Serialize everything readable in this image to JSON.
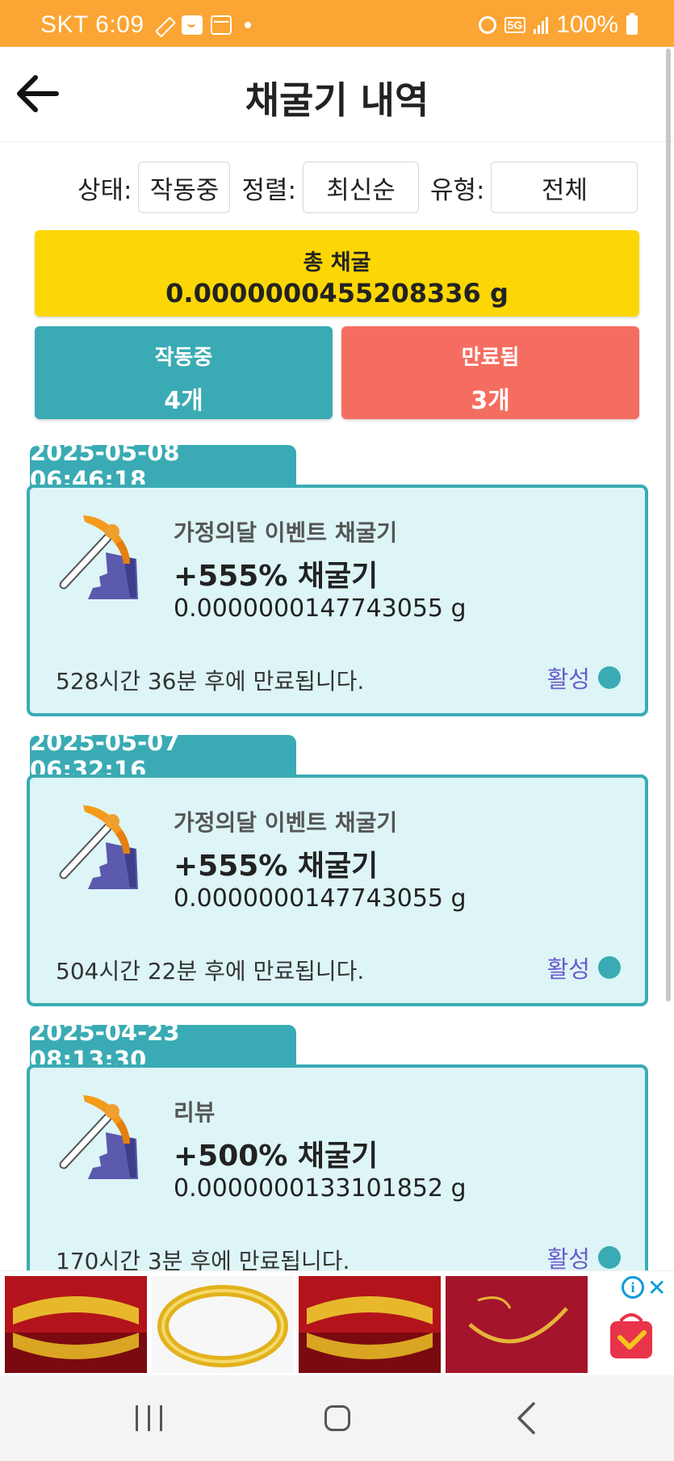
{
  "status_bar": {
    "carrier_time": "SKT 6:09",
    "network": "5G",
    "battery": "100%"
  },
  "header": {
    "title": "채굴기 내역"
  },
  "filters": {
    "status_label": "상태:",
    "status_value": "작동중",
    "sort_label": "정렬:",
    "sort_value": "최신순",
    "type_label": "유형:",
    "type_value": "전체"
  },
  "summary": {
    "total_label": "총 채굴",
    "total_value": "0.0000000455208336 g",
    "active_label": "작동중",
    "active_count": "4개",
    "expired_label": "만료됨",
    "expired_count": "3개"
  },
  "miners": [
    {
      "date": "2025-05-08 06:46:18",
      "name": "가정의달 이벤트 채굴기",
      "rate": "+555% 채굴기",
      "amount": "0.0000000147743055 g",
      "expiry": "528시간 36분 후에 만료됩니다.",
      "status": "활성"
    },
    {
      "date": "2025-05-07 06:32:16",
      "name": "가정의달 이벤트 채굴기",
      "rate": "+555% 채굴기",
      "amount": "0.0000000147743055 g",
      "expiry": "504시간 22분 후에 만료됩니다.",
      "status": "활성"
    },
    {
      "date": "2025-04-23 08:13:30",
      "name": "리뷰",
      "rate": "+500% 채굴기",
      "amount": "0.0000000133101852 g",
      "expiry": "170시간 3분 후에 만료됩니다.",
      "status": "활성"
    }
  ],
  "colors": {
    "status_bar": "#fba534",
    "total_box": "#fcd705",
    "active_box": "#3aabb4",
    "expired_box": "#f56d61",
    "card_bg": "#ddf5f6",
    "status_text": "#6a5acd"
  },
  "icons": [
    "pickaxe-rock-icon",
    "back-arrow-icon",
    "alarm-icon",
    "battery-icon",
    "ad-info-icon",
    "ad-close-icon",
    "shopping-bag-icon"
  ]
}
